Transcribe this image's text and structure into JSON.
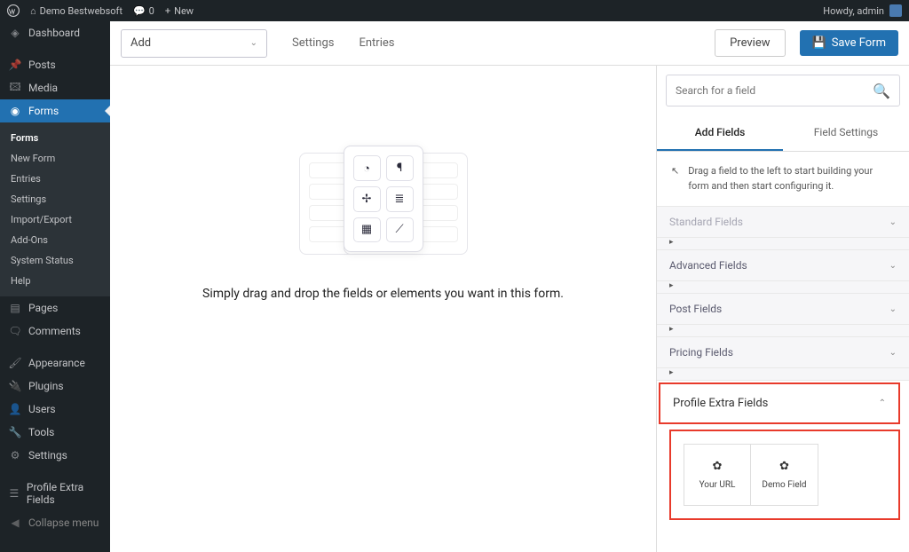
{
  "topbar": {
    "site": "Demo Bestwebsoft",
    "comments": "0",
    "new": "New",
    "howdy": "Howdy, admin"
  },
  "sidebar": {
    "dashboard": "Dashboard",
    "posts": "Posts",
    "media": "Media",
    "forms": "Forms",
    "sub": {
      "forms": "Forms",
      "newform": "New Form",
      "entries": "Entries",
      "settings": "Settings",
      "import": "Import/Export",
      "addons": "Add-Ons",
      "status": "System Status",
      "help": "Help"
    },
    "pages": "Pages",
    "comments": "Comments",
    "appearance": "Appearance",
    "plugins": "Plugins",
    "users": "Users",
    "tools": "Tools",
    "settings": "Settings",
    "profile_extra": "Profile Extra Fields",
    "collapse": "Collapse menu"
  },
  "toolbar": {
    "add": "Add",
    "settings": "Settings",
    "entries": "Entries",
    "preview": "Preview",
    "save": "Save Form"
  },
  "canvas": {
    "text": "Simply drag and drop the fields or elements you want in this form."
  },
  "right": {
    "search_ph": "Search for a field",
    "tab_add": "Add Fields",
    "tab_settings": "Field Settings",
    "hint": "Drag a field to the left to start building your form and then start configuring it.",
    "acc_standard": "Standard Fields",
    "acc_advanced": "Advanced Fields",
    "acc_post": "Post Fields",
    "acc_pricing": "Pricing Fields",
    "acc_profile": "Profile Extra Fields",
    "field1": "Your URL",
    "field2": "Demo Field"
  }
}
